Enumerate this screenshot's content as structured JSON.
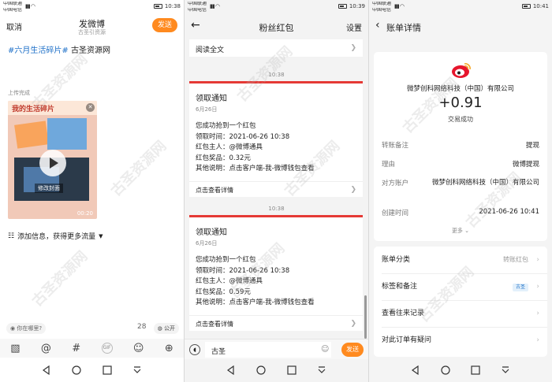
{
  "status_bars": [
    {
      "carrier1": "中国联通",
      "carrier2": "中国电信",
      "time": "10:38"
    },
    {
      "carrier1": "中国联通",
      "carrier2": "中国电信",
      "time": "10:39"
    },
    {
      "carrier1": "中国联通",
      "carrier2": "中国电信",
      "time": "10:41"
    }
  ],
  "compose": {
    "cancel": "取消",
    "title": "发微博",
    "subtitle": "古圣引资源",
    "send": "发送",
    "hashtag": "#六月生活碎片#",
    "text": " 古圣资源网",
    "upload_status": "上传完成",
    "thumb_title": "我的生活碎片",
    "edit_cover": "修改封面",
    "duration": "00:20",
    "add_info": "添加信息，获得更多流量",
    "location": "你在哪里?",
    "char_count": "28",
    "visibility": "公开"
  },
  "redpacket": {
    "title": "粉丝红包",
    "settings": "设置",
    "read_all": "阅读全文",
    "notices": [
      {
        "time": "10:38",
        "title": "领取通知",
        "date": "6月26日",
        "lines": [
          "您成功抢到一个红包",
          "领取时间：2021-06-26 10:38",
          "红包主人：@微博通具",
          "红包奖品：0.32元",
          "其他说明：点击客户端-我-微博钱包查看"
        ],
        "footer": "点击查看详情"
      },
      {
        "time": "10:38",
        "title": "领取通知",
        "date": "6月26日",
        "lines": [
          "您成功抢到一个红包",
          "领取时间：2021-06-26 10:38",
          "红包主人：@微博通具",
          "红包奖品：0.59元",
          "其他说明：点击客户端-我-微博钱包查看"
        ],
        "footer": "点击查看详情"
      }
    ],
    "input_value": "古圣",
    "send": "发送"
  },
  "bill": {
    "title": "账单详情",
    "merchant": "微梦创科网络科技（中国）有限公司",
    "amount": "+0.91",
    "status": "交易成功",
    "rows": [
      {
        "key": "转账备注",
        "value": "提现"
      },
      {
        "key": "理由",
        "value": "微博提现"
      },
      {
        "key": "对方账户",
        "value": "微梦创科网络科技（中国）有限公司"
      },
      {
        "key": "创建时间",
        "value": "2021-06-26 10:41"
      }
    ],
    "more": "更多",
    "options": [
      {
        "label": "账单分类",
        "value": "转账红包"
      },
      {
        "label": "标签和备注",
        "value": "古圣"
      },
      {
        "label": "查看往来记录",
        "value": ""
      },
      {
        "label": "对此订单有疑问",
        "value": ""
      }
    ]
  },
  "watermark": "古圣资源网",
  "colors": {
    "accent": "#ff8a1f",
    "link": "#1e70c8",
    "alert": "#e53935"
  }
}
